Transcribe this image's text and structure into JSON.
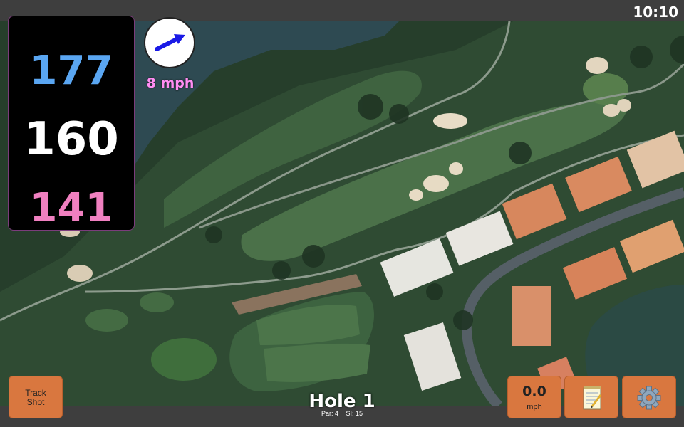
{
  "status_bar": {
    "time": "10:10"
  },
  "distances": {
    "back": "177",
    "middle": "160",
    "front": "141",
    "colors": {
      "back": "#5aa6f2",
      "middle": "#ffffff",
      "front": "#f080c0"
    }
  },
  "wind": {
    "speed_label": "8 mph",
    "direction_icon": "arrow-right-icon"
  },
  "hole": {
    "title": "Hole 1",
    "par_label": "Par: 4",
    "si_label": "SI: 15"
  },
  "buttons": {
    "track_shot_label": "Track\nShot",
    "speed_value": "0.0",
    "speed_unit": "mph",
    "scorecard_icon": "notepad-icon",
    "settings_icon": "gear-icon"
  },
  "theme": {
    "button_color": "#d9773f",
    "bar_color": "#3e3e3e"
  }
}
